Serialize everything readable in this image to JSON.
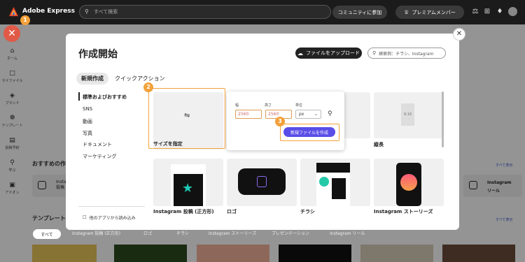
{
  "topbar": {
    "brand": "Adobe Express",
    "search_placeholder": "すべて検索",
    "community_button": "コミュニティに参加",
    "premium_button": "プレミアムメンバー"
  },
  "sidebar": {
    "items": [
      {
        "label": "ホーム",
        "icon": "home-icon"
      },
      {
        "label": "マイファイル",
        "icon": "folder-icon"
      },
      {
        "label": "ブランド",
        "icon": "brand-icon"
      },
      {
        "label": "テンプレート",
        "icon": "template-icon"
      },
      {
        "label": "投稿予約",
        "icon": "calendar-icon"
      },
      {
        "label": "学ぶ",
        "icon": "lightbulb-icon"
      },
      {
        "label": "アドオン",
        "icon": "addon-icon"
      }
    ]
  },
  "steps": [
    "1",
    "2",
    "3"
  ],
  "background": {
    "recommended_heading": "おすすめの作",
    "see_all": "すべて表示",
    "see_all_bottom": "すべて表示",
    "templates_heading": "テンプレート",
    "left_card_label": "Instagr\n投稿",
    "right_card_line1": "Instagram",
    "right_card_line2": "リール",
    "filters": [
      "すべて",
      "Instagram 投稿 (正方形)",
      "ロゴ",
      "チラシ",
      "Instagram ストーリーズ",
      "プレゼンテーション",
      "Instagram リール"
    ]
  },
  "modal": {
    "title": "作成開始",
    "upload_button": "ファイルをアップロード",
    "search_placeholder": "検索例：チラシ、Instagram",
    "tabs": [
      "新規作成",
      "クイックアクション"
    ],
    "categories": [
      "標準およびおすすめ",
      "SNS",
      "動画",
      "写真",
      "ドキュメント",
      "マーケティング"
    ],
    "import_label": "他のアプリから読み込み",
    "custom_size_label": "サイズを指定",
    "size_popup": {
      "width_label": "幅",
      "height_label": "高さ",
      "unit_label": "単位",
      "width_value": "2560",
      "height_value": "2560",
      "unit_value": "px",
      "create_button": "新規ファイルを作成"
    },
    "cards": [
      {
        "label": "縦長",
        "ratio": "9:16"
      },
      {
        "label": "Instagram 投稿 (正方形)"
      },
      {
        "label": "ロゴ"
      },
      {
        "label": "チラシ"
      },
      {
        "label": "Instagram ストーリーズ"
      }
    ]
  },
  "colors": {
    "accent": "#5a4ee8",
    "highlight": "#f3a13a",
    "close_red": "#e05a47"
  }
}
